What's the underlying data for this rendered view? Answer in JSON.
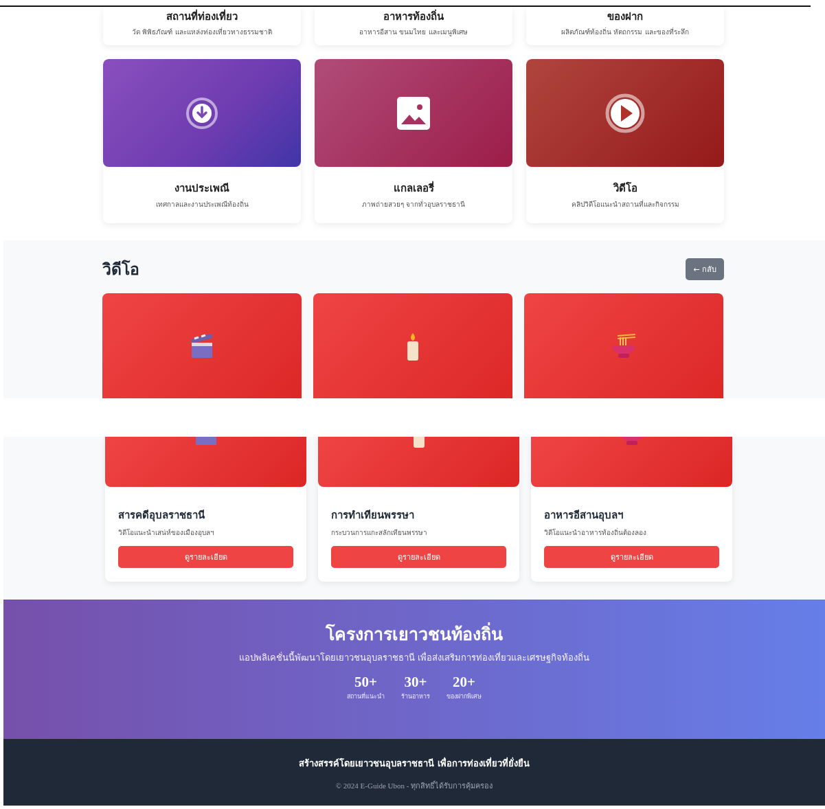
{
  "top_cards": [
    {
      "title": "สถานที่ท่องเที่ยว",
      "description": "วัด พิพิธภัณฑ์ และแหล่งท่องเที่ยวทางธรรมชาติ"
    },
    {
      "title": "อาหารท้องถิ่น",
      "description": "อาหารอีสาน ขนมไทย และเมนูพิเศษ"
    },
    {
      "title": "ของฝาก",
      "description": "ผลิตภัณฑ์ท้องถิ่น หัตถกรรม และของที่ระลึก"
    }
  ],
  "categories": [
    {
      "kind": "download",
      "title": "งานประเพณี",
      "description": "เทศกาลและงานประเพณีท้องถิ่น"
    },
    {
      "kind": "image",
      "title": "แกลเลอรี่",
      "description": "ภาพถ่ายสวยๆ จากทั่วอุบลราชธานี"
    },
    {
      "kind": "play",
      "title": "วิดีโอ",
      "description": "คลิปวิดีโอแนะนำสถานที่และกิจกรรม"
    }
  ],
  "video_section": {
    "title": "วิดีโอ",
    "back_button": "← กลับ",
    "videos": [
      {
        "kind": "clapper",
        "title": "สารคดีอุบลราชธานี",
        "description": "วิดีโอแนะนำเสน่ห์ของเมืองอุบลฯ",
        "button": "ดูรายละเอียด"
      },
      {
        "kind": "candle",
        "title": "การทำเทียนพรรษา",
        "description": "กระบวนการแกะสลักเทียนพรรษา",
        "button": "ดูรายละเอียด"
      },
      {
        "kind": "noodles",
        "title": "อาหารอีสานอุบลฯ",
        "description": "วิดีโอแนะนำอาหารท้องถิ่นต้องลอง",
        "button": "ดูรายละเอียด"
      }
    ]
  },
  "project": {
    "title": "โครงการเยาวชนท้องถิ่น",
    "description": "แอปพลิเคชั่นนี้พัฒนาโดยเยาวชนอุบลราชธานี เพื่อส่งเสริมการท่องเที่ยวและเศรษฐกิจท้องถิ่น",
    "stats": [
      {
        "value": "50+",
        "label": "สถานที่แนะนำ"
      },
      {
        "value": "30+",
        "label": "ร้านอาหาร"
      },
      {
        "value": "20+",
        "label": "ของฝากพิเศษ"
      }
    ]
  },
  "footer": {
    "text": "สร้างสรรค์โดยเยาวชนอุบลราชธานี เพื่อการท่องเที่ยวที่ยั่งยืน",
    "copyright": "© 2024 E-Guide Ubon - ทุกสิทธิ์ได้รับการคุ้มครอง"
  }
}
